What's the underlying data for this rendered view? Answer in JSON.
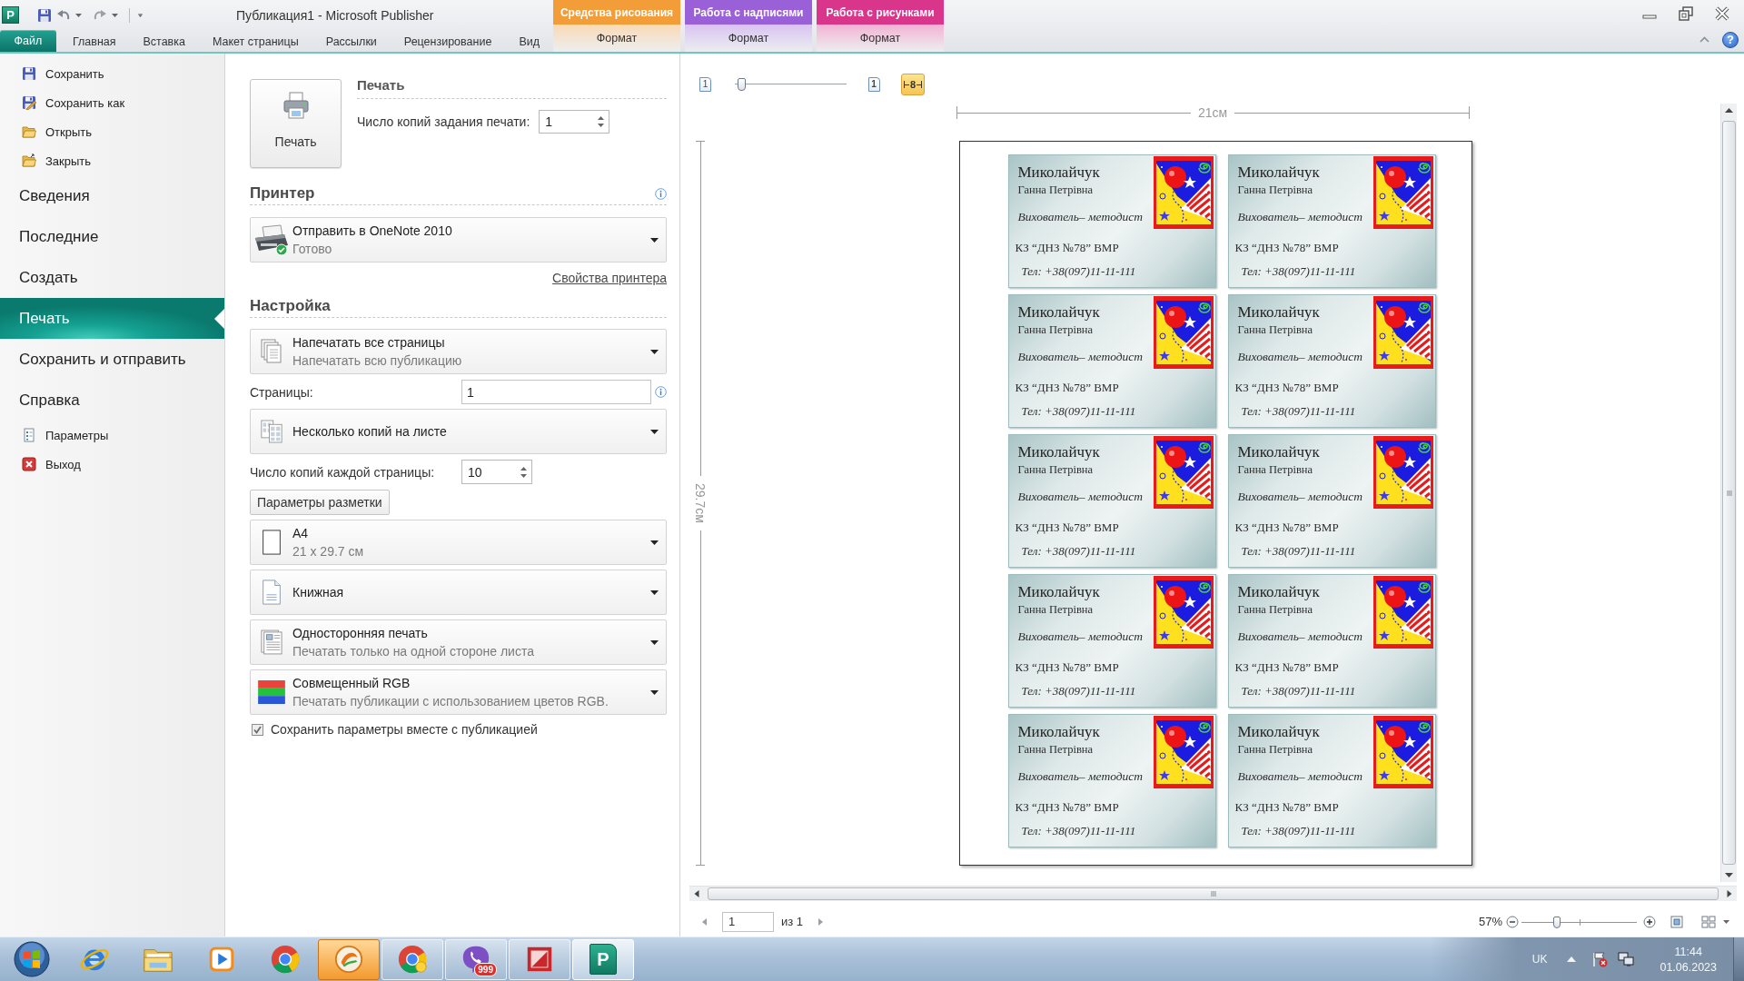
{
  "window": {
    "app_icon_text": "P",
    "title": "Публикация1 - Microsoft Publisher",
    "help_button": "?"
  },
  "context_tabs": [
    {
      "group": "Средства рисования",
      "tab": "Формат",
      "color": "#f29d38"
    },
    {
      "group": "Работа с надписями",
      "tab": "Формат",
      "color": "#9a60d8"
    },
    {
      "group": "Работа с рисунками",
      "tab": "Формат",
      "color": "#d9368b"
    }
  ],
  "ribbon_tabs": [
    {
      "label": "Файл",
      "kind": "file",
      "selected": true
    },
    {
      "label": "Главная",
      "kind": "tab",
      "selected": false
    },
    {
      "label": "Вставка",
      "kind": "tab",
      "selected": false
    },
    {
      "label": "Макет страницы",
      "kind": "tab",
      "selected": false
    },
    {
      "label": "Рассылки",
      "kind": "tab",
      "selected": false
    },
    {
      "label": "Рецензирование",
      "kind": "tab",
      "selected": false
    },
    {
      "label": "Вид",
      "kind": "tab",
      "selected": false
    }
  ],
  "backstage": {
    "items": [
      {
        "label": "Сохранить",
        "kind": "command",
        "selected": false
      },
      {
        "label": "Сохранить как",
        "kind": "command",
        "selected": false
      },
      {
        "label": "Открыть",
        "kind": "command",
        "selected": false
      },
      {
        "label": "Закрыть",
        "kind": "command",
        "selected": false
      },
      {
        "label": "Сведения",
        "kind": "section",
        "selected": false
      },
      {
        "label": "Последние",
        "kind": "section",
        "selected": false
      },
      {
        "label": "Создать",
        "kind": "section",
        "selected": false
      },
      {
        "label": "Печать",
        "kind": "section",
        "selected": true
      },
      {
        "label": "Сохранить и отправить",
        "kind": "section",
        "selected": false
      },
      {
        "label": "Справка",
        "kind": "section",
        "selected": false
      },
      {
        "label": "Параметры",
        "kind": "command",
        "selected": false
      },
      {
        "label": "Выход",
        "kind": "command",
        "selected": false
      }
    ]
  },
  "print": {
    "heading": "Печать",
    "button": "Печать",
    "copies_label": "Число копий задания печати:",
    "copies": "1"
  },
  "printer": {
    "heading": "Принтер",
    "name": "Отправить в OneNote 2010",
    "status": "Готово",
    "properties_link": "Свойства принтера"
  },
  "settings": {
    "heading": "Настройка",
    "items": [
      {
        "kind": "dropdown",
        "title": "Напечатать все страницы",
        "subtitle": "Напечатать всю публикацию"
      },
      {
        "kind": "field",
        "label": "Страницы:",
        "value": "1"
      },
      {
        "kind": "dropdown",
        "title": "Несколько копий на листе"
      },
      {
        "kind": "spin",
        "label": "Число копий каждой страницы:",
        "value": "10"
      },
      {
        "kind": "button",
        "label": "Параметры разметки"
      },
      {
        "kind": "dropdown",
        "title": "A4",
        "subtitle": "21 x 29.7 см"
      },
      {
        "kind": "dropdown",
        "title": "Книжная"
      },
      {
        "kind": "dropdown",
        "title": "Односторонняя печать",
        "subtitle": "Печатать только на одной стороне листа"
      },
      {
        "kind": "dropdown",
        "title": "Совмещенный RGB",
        "subtitle": "Печатать публикации с использованием цветов RGB."
      },
      {
        "kind": "checkbox",
        "label": "Сохранить параметры вместе с публикацией",
        "checked": true
      }
    ]
  },
  "preview": {
    "pages_slider": {
      "icon_text": "1",
      "level": 0.03
    },
    "view_buttons": [
      {
        "icon_text": "1",
        "selected": false
      },
      {
        "icon_text": "8",
        "selected": true
      }
    ],
    "width_ruler": "21см",
    "height_ruler": "29.7см",
    "cards": [
      {
        "surname": "Миколайчук",
        "name": "Ганна Петрівна",
        "position": "Вихователь– методист",
        "organization": "КЗ “ДНЗ №78” ВМР",
        "phone": "Тел: +38(097)11-11-111"
      },
      {
        "surname": "Миколайчук",
        "name": "Ганна Петрівна",
        "position": "Вихователь– методист",
        "organization": "КЗ “ДНЗ №78” ВМР",
        "phone": "Тел: +38(097)11-11-111"
      },
      {
        "surname": "Миколайчук",
        "name": "Ганна Петрівна",
        "position": "Вихователь– методист",
        "organization": "КЗ “ДНЗ №78” ВМР",
        "phone": "Тел: +38(097)11-11-111"
      },
      {
        "surname": "Миколайчук",
        "name": "Ганна Петрівна",
        "position": "Вихователь– методист",
        "organization": "КЗ “ДНЗ №78” ВМР",
        "phone": "Тел: +38(097)11-11-111"
      },
      {
        "surname": "Миколайчук",
        "name": "Ганна Петрівна",
        "position": "Вихователь– методист",
        "organization": "КЗ “ДНЗ №78” ВМР",
        "phone": "Тел: +38(097)11-11-111"
      },
      {
        "surname": "Миколайчук",
        "name": "Ганна Петрівна",
        "position": "Вихователь– методист",
        "organization": "КЗ “ДНЗ №78” ВМР",
        "phone": "Тел: +38(097)11-11-111"
      },
      {
        "surname": "Миколайчук",
        "name": "Ганна Петрівна",
        "position": "Вихователь– методист",
        "organization": "КЗ “ДНЗ №78” ВМР",
        "phone": "Тел: +38(097)11-11-111"
      },
      {
        "surname": "Миколайчук",
        "name": "Ганна Петрівна",
        "position": "Вихователь– методист",
        "organization": "КЗ “ДНЗ №78” ВМР",
        "phone": "Тел: +38(097)11-11-111"
      },
      {
        "surname": "Миколайчук",
        "name": "Ганна Петрівна",
        "position": "Вихователь– методист",
        "organization": "КЗ “ДНЗ №78” ВМР",
        "phone": "Тел: +38(097)11-11-111"
      },
      {
        "surname": "Миколайчук",
        "name": "Ганна Петрівна",
        "position": "Вихователь– методист",
        "organization": "КЗ “ДНЗ №78” ВМР",
        "phone": "Тел: +38(097)11-11-111"
      }
    ]
  },
  "status_bar": {
    "page": "1",
    "page_count": "из 1",
    "zoom": "57%",
    "zoom_slider": {
      "level": 0.3
    }
  },
  "taskbar": {
    "apps": [
      {
        "running": false,
        "flashing": false,
        "selected": false
      },
      {
        "running": false,
        "flashing": false,
        "selected": false
      },
      {
        "running": false,
        "flashing": false,
        "selected": false
      },
      {
        "running": false,
        "flashing": false,
        "selected": false
      },
      {
        "running": true,
        "flashing": true,
        "selected": false
      },
      {
        "running": true,
        "flashing": false,
        "selected": false
      },
      {
        "running": true,
        "flashing": false,
        "selected": false,
        "badge": "999"
      },
      {
        "running": true,
        "flashing": false,
        "selected": false
      },
      {
        "running": true,
        "flashing": false,
        "selected": true,
        "icon_text": "P"
      }
    ],
    "language": "UK",
    "time": "11:44",
    "date": "01.06.2023"
  }
}
